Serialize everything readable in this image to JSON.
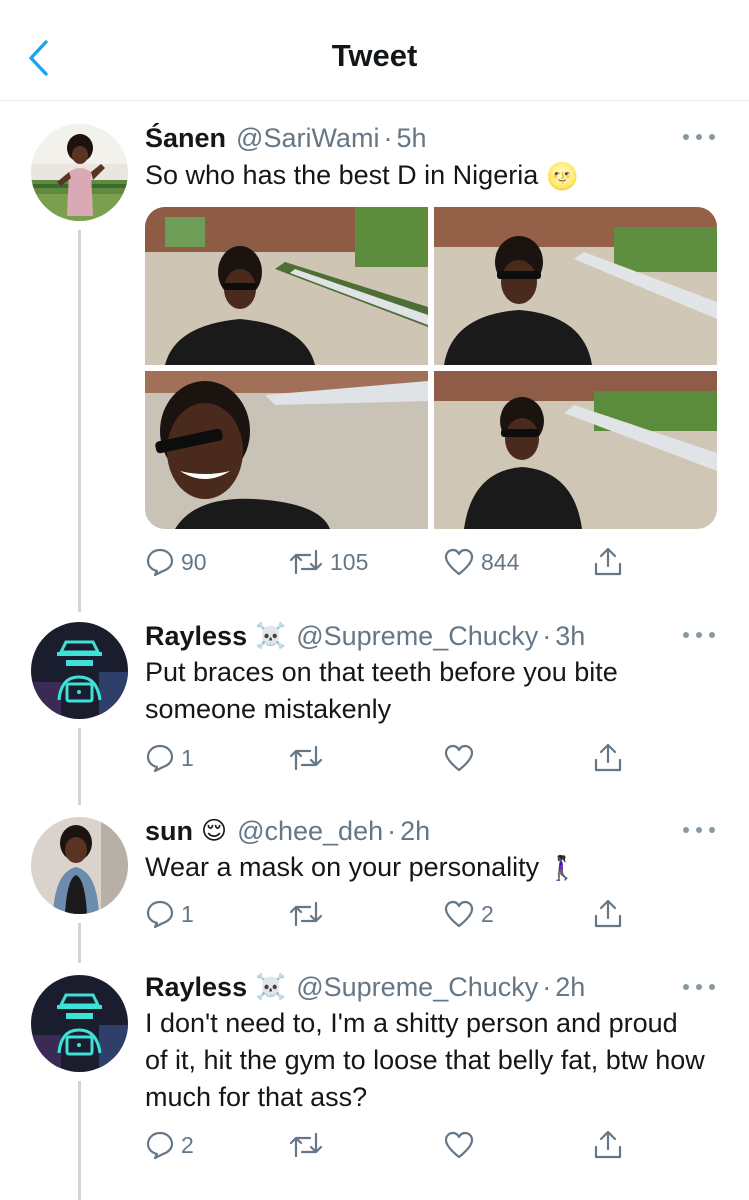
{
  "header": {
    "title": "Tweet"
  },
  "colors": {
    "accent": "#1da1f2",
    "secondary_text": "#657786",
    "icon": "#657786",
    "thread_line": "#cdd6dd"
  },
  "main_tweet": {
    "display_name": "Śanen",
    "handle": "@SariWami",
    "time": "5h",
    "text": "So who has the best D in Nigeria",
    "text_emoji": "🌝",
    "replies": "90",
    "retweets": "105",
    "likes": "844"
  },
  "replies": [
    {
      "display_name": "Rayless",
      "name_emoji": "☠️",
      "handle": "@Supreme_Chucky",
      "time": "3h",
      "text": "Put braces on that teeth before you bite someone mistakenly",
      "replies": "1",
      "retweets": "",
      "likes": ""
    },
    {
      "display_name": "sun",
      "name_emoji": "😌",
      "handle": "@chee_deh",
      "time": "2h",
      "text": "Wear a mask on your personality",
      "text_emoji": "🚶🏿‍♀️",
      "replies": "1",
      "retweets": "",
      "likes": "2"
    },
    {
      "display_name": "Rayless",
      "name_emoji": "☠️",
      "handle": "@Supreme_Chucky",
      "time": "2h",
      "text": "I don't need to, I'm a shitty person and proud of it, hit the gym to loose that belly fat, btw how much for that ass?",
      "replies": "2",
      "retweets": "",
      "likes": ""
    }
  ]
}
